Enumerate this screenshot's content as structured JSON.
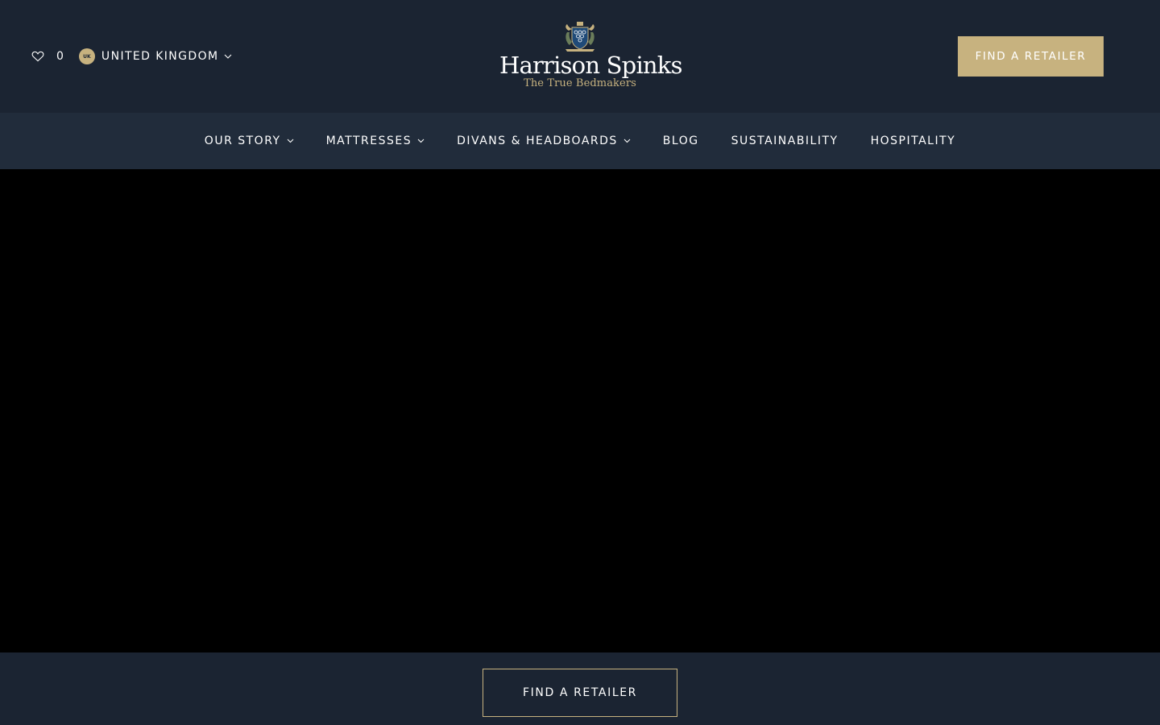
{
  "header": {
    "wishlist": {
      "icon": "heart-icon",
      "count": "0"
    },
    "country": {
      "code": "UK",
      "name": "UNITED KINGDOM",
      "icon": "chevron-down-icon"
    },
    "logo": {
      "name": "Harrison Spinks",
      "tagline": "The True Bedmakers",
      "crest": "crest-icon"
    },
    "cta_label": "FIND A RETAILER"
  },
  "nav": {
    "items": [
      {
        "label": "OUR STORY",
        "has_dropdown": true
      },
      {
        "label": "MATTRESSES",
        "has_dropdown": true
      },
      {
        "label": "DIVANS & HEADBOARDS",
        "has_dropdown": true
      },
      {
        "label": "BLOG",
        "has_dropdown": false
      },
      {
        "label": "SUSTAINABILITY",
        "has_dropdown": false
      },
      {
        "label": "HOSPITALITY",
        "has_dropdown": false
      }
    ]
  },
  "footer": {
    "cta_label": "FIND A RETAILER"
  },
  "colors": {
    "header_bg": "#1b2432",
    "nav_bg": "#212c3b",
    "accent_gold": "#c7b27f",
    "hero_bg": "#000000"
  }
}
